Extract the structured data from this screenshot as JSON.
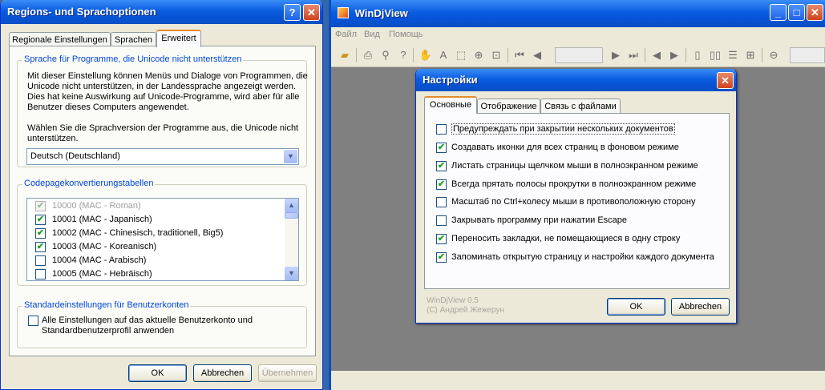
{
  "regions_dialog": {
    "title": "Regions- und Sprachoptionen",
    "help_button": "?",
    "close_button": "✕",
    "tabs": [
      "Regionale Einstellungen",
      "Sprachen",
      "Erweitert"
    ],
    "active_tab": "Erweitert",
    "unicode_group": {
      "title": "Sprache für Programme, die Unicode nicht unterstützen",
      "description": [
        "Mit dieser Einstellung können Menüs und Dialoge von Programmen, die",
        "Unicode nicht unterstützen, in der Landessprache angezeigt werden.",
        "Dies hat keine Auswirkung auf Unicode-Programme, wird aber für alle",
        "Benutzer dieses Computers angewendet."
      ],
      "select_prompt_line1": "Wählen Sie die Sprachversion der Programme aus, die Unicode nicht",
      "select_prompt_line2": "unterstützen.",
      "selected_language": "Deutsch (Deutschland)"
    },
    "codepage_group": {
      "title": "Codepagekonvertierungstabellen",
      "items": [
        {
          "label": "10000 (MAC - Roman)",
          "checked": true,
          "disabled": true
        },
        {
          "label": "10001 (MAC - Japanisch)",
          "checked": true,
          "disabled": false
        },
        {
          "label": "10002 (MAC - Chinesisch, traditionell, Big5)",
          "checked": true,
          "disabled": false
        },
        {
          "label": "10003 (MAC - Koreanisch)",
          "checked": true,
          "disabled": false
        },
        {
          "label": "10004 (MAC - Arabisch)",
          "checked": false,
          "disabled": false
        },
        {
          "label": "10005 (MAC - Hebräisch)",
          "checked": false,
          "disabled": false
        }
      ]
    },
    "defaults_group": {
      "title": "Standardeinstellungen für Benutzerkonten",
      "checkbox_line1": "Alle Einstellungen auf das aktuelle Benutzerkonto und",
      "checkbox_line2": "Standardbenutzerprofil anwenden",
      "checked": false
    },
    "buttons": {
      "ok": "OK",
      "cancel": "Abbrechen",
      "apply": "Übernehmen"
    }
  },
  "windjview": {
    "title": "WinDjView",
    "menu": [
      "Файл",
      "Вид",
      "Помощь"
    ]
  },
  "settings_dialog": {
    "title": "Настройки",
    "close_button": "✕",
    "tabs": [
      "Основные",
      "Отображение",
      "Связь с файлами"
    ],
    "active_tab": "Основные",
    "options": [
      {
        "label": "Предупреждать при закрытии нескольких документов",
        "checked": false
      },
      {
        "label": "Создавать иконки для всех страниц в фоновом режиме",
        "checked": true
      },
      {
        "label": "Листать страницы щелчком мыши в полноэкранном режиме",
        "checked": true
      },
      {
        "label": "Всегда прятать полосы прокрутки в полноэкранном режиме",
        "checked": true
      },
      {
        "label": "Масштаб по Ctrl+колесу мыши в противоположную сторону",
        "checked": false
      },
      {
        "label": "Закрывать программу при нажатии Escape",
        "checked": false
      },
      {
        "label": "Переносить закладки, не помещающиеся в одну строку",
        "checked": true
      },
      {
        "label": "Запоминать открытую страницу и настройки каждого документа",
        "checked": true
      }
    ],
    "version_line1": "WinDjView 0.5",
    "version_line2": "(C) Андрей Жежерун",
    "buttons": {
      "ok": "OK",
      "cancel": "Abbrechen"
    }
  },
  "colors": {
    "xp_blue": "#0a5de0",
    "dialog_bg": "#ece9d8",
    "group_title": "#0046d5",
    "check_green": "#21a121"
  }
}
